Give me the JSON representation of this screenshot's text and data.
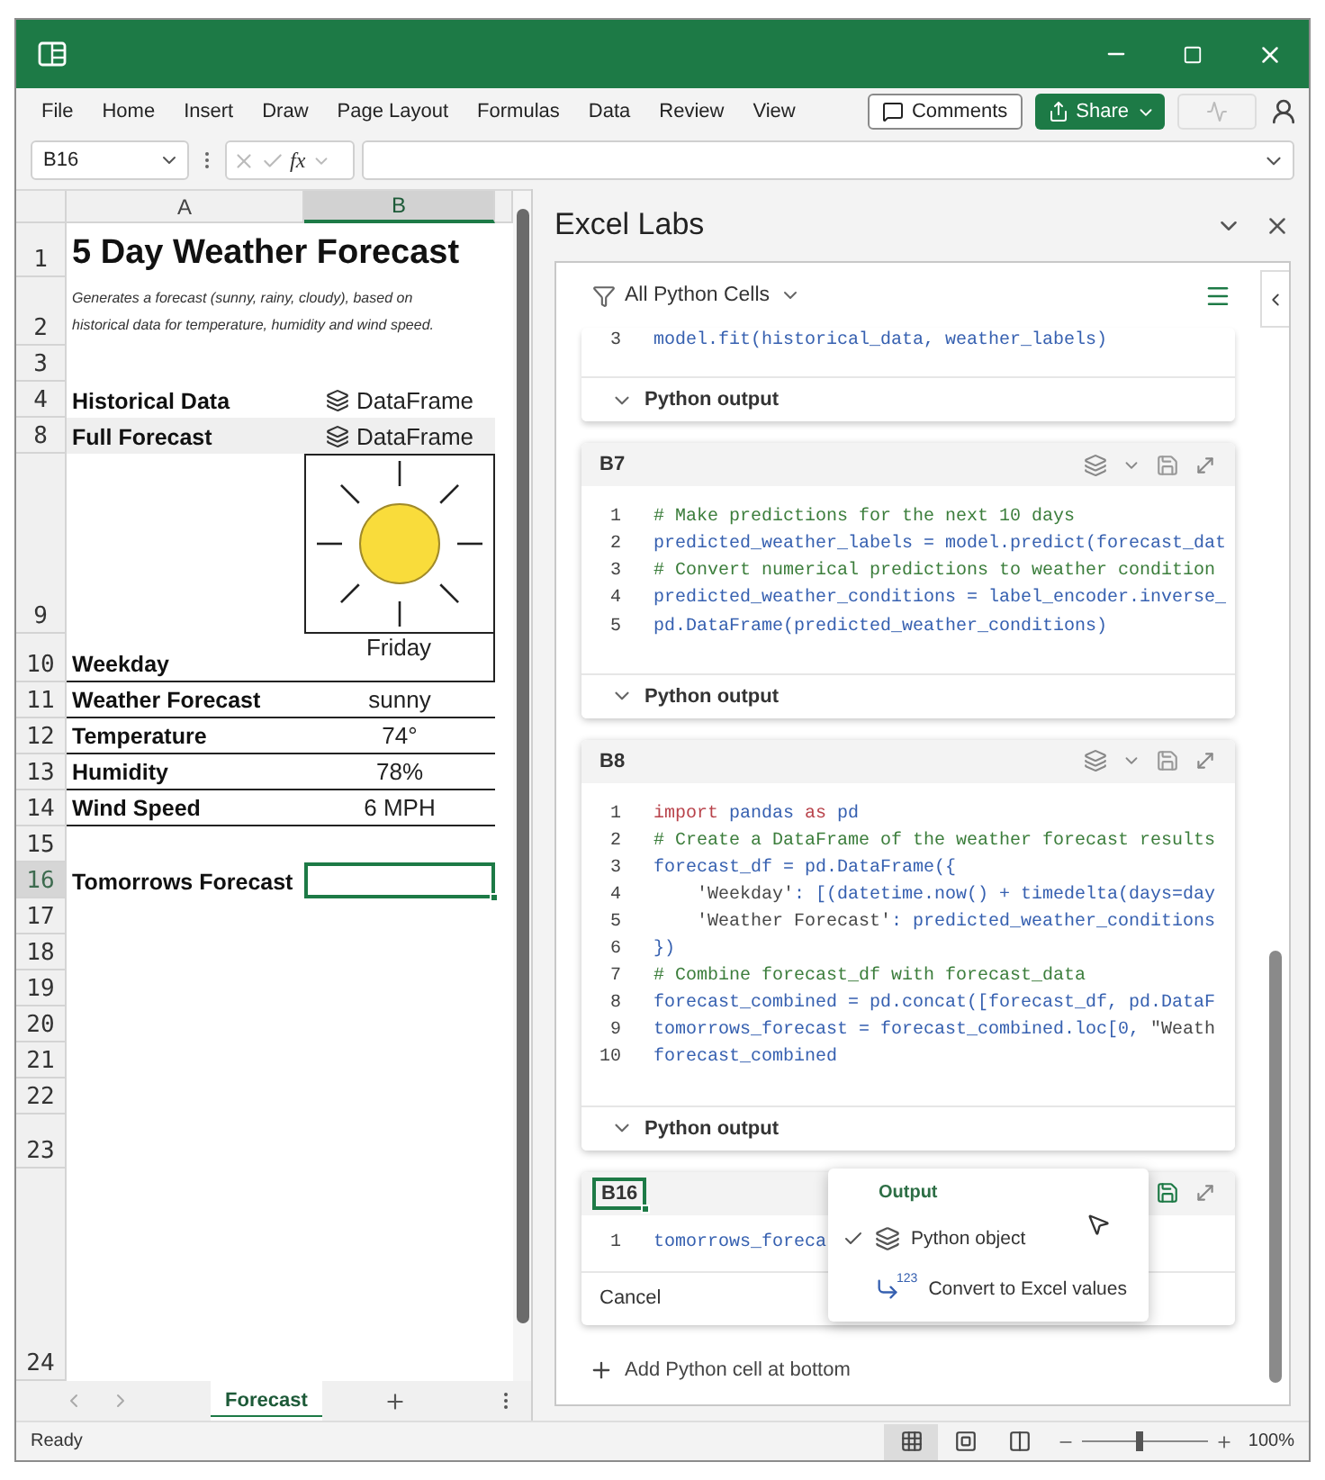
{
  "ribbon": {
    "tabs": [
      "File",
      "Home",
      "Insert",
      "Draw",
      "Page Layout",
      "Formulas",
      "Data",
      "Review",
      "View"
    ],
    "comments": "Comments",
    "share": "Share"
  },
  "formula_bar": {
    "name_box": "B16",
    "function_label": "fx"
  },
  "sheet": {
    "columns": [
      {
        "label": "A",
        "selected": false
      },
      {
        "label": "B",
        "selected": true
      }
    ],
    "rows": [
      {
        "number": "1",
        "selected": false,
        "kind": "title",
        "label": "5 Day Weather Forecast"
      },
      {
        "number": "2",
        "selected": false,
        "kind": "note",
        "label": "Generates a forecast (sunny, rainy, cloudy), based on historical data for temperature, humidity and wind speed."
      },
      {
        "number": "3",
        "selected": false,
        "kind": "blank"
      },
      {
        "number": "4",
        "selected": false,
        "kind": "dataframe",
        "label": "Historical Data",
        "value": "DataFrame",
        "highlighted": false
      },
      {
        "number": "8",
        "selected": false,
        "kind": "dataframe",
        "label": "Full Forecast",
        "value": "DataFrame",
        "highlighted": true
      },
      {
        "number": "9",
        "selected": false,
        "kind": "image"
      },
      {
        "number": "10",
        "selected": false,
        "kind": "value",
        "label": "Weekday",
        "value": "Friday"
      },
      {
        "number": "11",
        "selected": false,
        "kind": "value",
        "label": "Weather Forecast",
        "value": "sunny"
      },
      {
        "number": "12",
        "selected": false,
        "kind": "value",
        "label": "Temperature",
        "value": "74°"
      },
      {
        "number": "13",
        "selected": false,
        "kind": "value",
        "label": "Humidity",
        "value": "78%"
      },
      {
        "number": "14",
        "selected": false,
        "kind": "value",
        "label": "Wind Speed",
        "value": "6 MPH"
      },
      {
        "number": "15",
        "selected": false,
        "kind": "blank"
      },
      {
        "number": "16",
        "selected": true,
        "kind": "input",
        "label": "Tomorrows Forecast"
      },
      {
        "number": "17",
        "selected": false,
        "kind": "blank"
      },
      {
        "number": "18",
        "selected": false,
        "kind": "blank"
      },
      {
        "number": "19",
        "selected": false,
        "kind": "blank"
      },
      {
        "number": "20",
        "selected": false,
        "kind": "blank"
      },
      {
        "number": "21",
        "selected": false,
        "kind": "blank"
      },
      {
        "number": "22",
        "selected": false,
        "kind": "blank"
      },
      {
        "number": "23",
        "selected": false,
        "kind": "blank"
      },
      {
        "number": "24",
        "selected": false,
        "kind": "blank"
      }
    ],
    "tabs": [
      {
        "label": "Forecast",
        "selected": true
      }
    ]
  },
  "panel": {
    "title": "Excel Labs",
    "filter": "All Python Cells",
    "cells": [
      {
        "kind": "partial",
        "output": "Python output",
        "lines": [
          {
            "number": "3",
            "tokens": [
              {
                "kind": "code",
                "text": "model.fit(historical_data, weather_labels)"
              }
            ]
          }
        ]
      },
      {
        "kind": "cell",
        "ref": "B7",
        "active": false,
        "output": "Python output",
        "lines": [
          {
            "number": "1",
            "tokens": [
              {
                "kind": "comment",
                "text": "# Make predictions for the next 10 days"
              }
            ]
          },
          {
            "number": "2",
            "tokens": [
              {
                "kind": "code",
                "text": "predicted_weather_labels = model.predict(forecast_dat"
              }
            ]
          },
          {
            "number": "3",
            "tokens": [
              {
                "kind": "comment",
                "text": "# Convert numerical predictions to weather condition"
              }
            ]
          },
          {
            "number": "4",
            "tokens": [
              {
                "kind": "code",
                "text": "predicted_weather_conditions = label_encoder.inverse_"
              }
            ]
          },
          {
            "number": "5",
            "tokens": [
              {
                "kind": "code",
                "text": "pd.DataFrame(predicted_weather_conditions)"
              }
            ]
          }
        ]
      },
      {
        "kind": "cell",
        "ref": "B8",
        "active": false,
        "output": "Python output",
        "lines": [
          {
            "number": "1",
            "tokens": [
              {
                "kind": "keyword",
                "text": "import"
              },
              {
                "kind": "code",
                "text": " pandas "
              },
              {
                "kind": "keyword",
                "text": "as"
              },
              {
                "kind": "code",
                "text": " pd"
              }
            ]
          },
          {
            "number": "2",
            "tokens": [
              {
                "kind": "comment",
                "text": "# Create a DataFrame of the weather forecast results"
              }
            ]
          },
          {
            "number": "3",
            "tokens": [
              {
                "kind": "code",
                "text": "forecast_df = pd.DataFrame({"
              }
            ]
          },
          {
            "number": "4",
            "tokens": [
              {
                "kind": "string",
                "text": "    'Weekday'"
              },
              {
                "kind": "code",
                "text": ": [(datetime.now() + timedelta(days=day"
              }
            ]
          },
          {
            "number": "5",
            "tokens": [
              {
                "kind": "string",
                "text": "    'Weather Forecast'"
              },
              {
                "kind": "code",
                "text": ": predicted_weather_conditions"
              }
            ]
          },
          {
            "number": "6",
            "tokens": [
              {
                "kind": "code",
                "text": "})"
              }
            ]
          },
          {
            "number": "7",
            "tokens": [
              {
                "kind": "comment",
                "text": "# Combine forecast_df with forecast_data"
              }
            ]
          },
          {
            "number": "8",
            "tokens": [
              {
                "kind": "code",
                "text": "forecast_combined = pd.concat([forecast_df, pd.DataF"
              }
            ]
          },
          {
            "number": "9",
            "tokens": [
              {
                "kind": "code",
                "text": "tomorrows_forecast = forecast_combined.loc[0, "
              },
              {
                "kind": "string",
                "text": "\"Weath"
              }
            ]
          },
          {
            "number": "10",
            "tokens": [
              {
                "kind": "code",
                "text": "forecast_combined"
              }
            ]
          }
        ]
      },
      {
        "kind": "editing",
        "ref": "B16",
        "active": true,
        "cancel": "Cancel",
        "lines": [
          {
            "number": "1",
            "tokens": [
              {
                "kind": "code",
                "text": "tomorrows_foreca"
              }
            ]
          }
        ],
        "menu": {
          "heading": "Output",
          "items": [
            {
              "kind": "python",
              "label": "Python object",
              "checked": true
            },
            {
              "kind": "convert",
              "label": "Convert to Excel values",
              "checked": false,
              "badge": "123"
            }
          ]
        }
      }
    ],
    "add_cell": "Add Python cell at bottom"
  },
  "status_bar": {
    "status": "Ready",
    "views": [
      {
        "kind": "normal",
        "selected": true
      },
      {
        "kind": "page_layout",
        "selected": false
      },
      {
        "kind": "page_break",
        "selected": false
      }
    ],
    "zoom": {
      "level": 0.45,
      "reading": "100%"
    }
  }
}
